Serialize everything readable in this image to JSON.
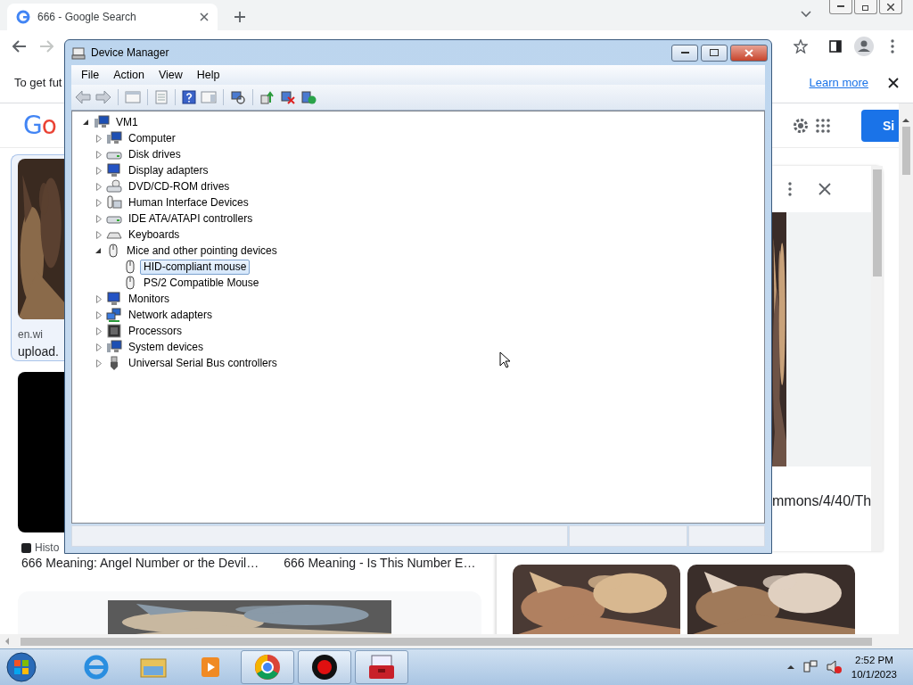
{
  "browser": {
    "tab": {
      "title": "666 - Google Search"
    },
    "infobar": {
      "text": "To get fut",
      "link": "Learn more"
    },
    "logo": "Go",
    "signin": "Si",
    "left_card": {
      "source": "en.wi",
      "caption": "upload."
    },
    "history_label": "Histo",
    "titles": [
      "666 Meaning: Angel Number or the Devil…",
      "666 Meaning - Is This Number E…"
    ],
    "side_panel": {
      "url": "mmons/4/40/Th"
    }
  },
  "window": {
    "title": "Device Manager",
    "menu": [
      "File",
      "Action",
      "View",
      "Help"
    ],
    "tree": {
      "label": "VM1",
      "kind": "computer",
      "expanded": true,
      "selected": false,
      "children": [
        {
          "label": "Computer",
          "kind": "computer",
          "expanded": false,
          "selected": false
        },
        {
          "label": "Disk drives",
          "kind": "disk",
          "expanded": false,
          "selected": false
        },
        {
          "label": "Display adapters",
          "kind": "display",
          "expanded": false,
          "selected": false
        },
        {
          "label": "DVD/CD-ROM drives",
          "kind": "dvd",
          "expanded": false,
          "selected": false
        },
        {
          "label": "Human Interface Devices",
          "kind": "hid",
          "expanded": false,
          "selected": false
        },
        {
          "label": "IDE ATA/ATAPI controllers",
          "kind": "disk",
          "expanded": false,
          "selected": false
        },
        {
          "label": "Keyboards",
          "kind": "keyboard",
          "expanded": false,
          "selected": false
        },
        {
          "label": "Mice and other pointing devices",
          "kind": "mouse",
          "expanded": true,
          "selected": false,
          "children": [
            {
              "label": "HID-compliant mouse",
              "kind": "mouse",
              "selected": true
            },
            {
              "label": "PS/2 Compatible Mouse",
              "kind": "mouse",
              "selected": false
            }
          ]
        },
        {
          "label": "Monitors",
          "kind": "display",
          "expanded": false,
          "selected": false
        },
        {
          "label": "Network adapters",
          "kind": "network",
          "expanded": false,
          "selected": false
        },
        {
          "label": "Processors",
          "kind": "processor",
          "expanded": false,
          "selected": false
        },
        {
          "label": "System devices",
          "kind": "computer",
          "expanded": false,
          "selected": false
        },
        {
          "label": "Universal Serial Bus controllers",
          "kind": "usb",
          "expanded": false,
          "selected": false
        }
      ]
    }
  },
  "taskbar": {
    "apps": [
      {
        "kind": "ie",
        "open": false
      },
      {
        "kind": "folder",
        "open": false
      },
      {
        "kind": "media",
        "open": false
      },
      {
        "kind": "chrome",
        "open": true
      },
      {
        "kind": "record",
        "open": true
      },
      {
        "kind": "toolbox",
        "open": true
      }
    ],
    "time": "2:52 PM",
    "date": "10/1/2023"
  }
}
